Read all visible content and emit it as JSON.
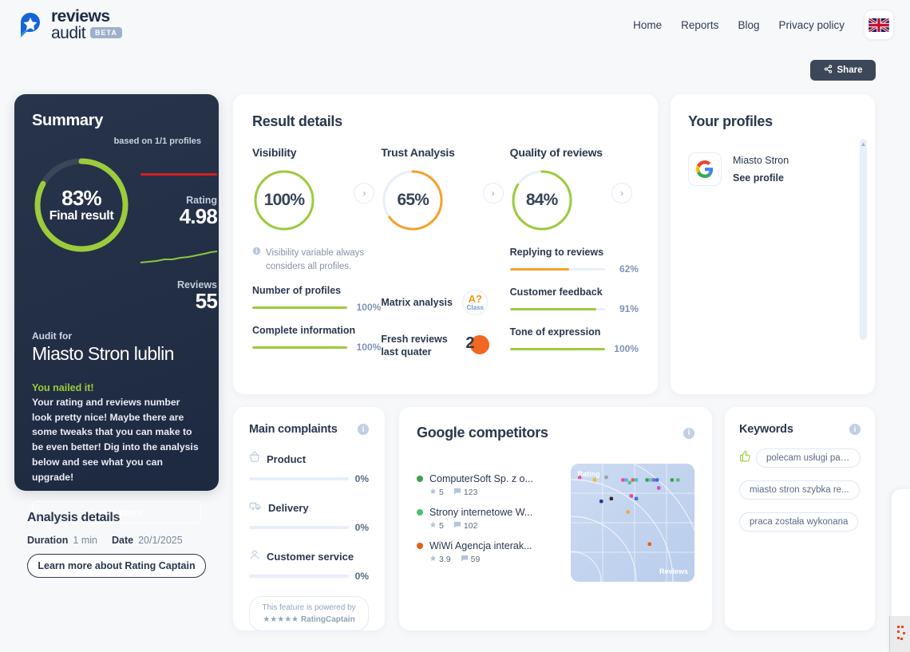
{
  "brand": {
    "line1": "reviews",
    "line2": "audit",
    "badge": "BETA",
    "logo_icon": "star-speech-bubble-icon"
  },
  "nav": {
    "items": [
      {
        "label": "Home"
      },
      {
        "label": "Reports"
      },
      {
        "label": "Blog"
      },
      {
        "label": "Privacy policy"
      }
    ],
    "language_flag": "uk-flag-icon"
  },
  "share": {
    "label": "Share",
    "icon": "share-icon"
  },
  "summary": {
    "title": "Summary",
    "based_on": "based on 1/1 profiles",
    "final_percent": "83%",
    "final_label": "Final result",
    "final_value": 83,
    "rating_label": "Rating",
    "rating_value": "4.98",
    "reviews_label": "Reviews",
    "reviews_value": "55",
    "audit_for_label": "Audit for",
    "audit_name": "Miasto Stron lublin",
    "headline": "You nailed it!",
    "body": "Your rating and reviews number look pretty nice! Maybe there are some tweaks that you can make to be even better! Dig into the analysis below and see what you can upgrade!",
    "cta": "Learn more",
    "ring_color": "#9ccb3b",
    "accent_red": "#d61f1f"
  },
  "analysis": {
    "title": "Analysis details",
    "duration_label": "Duration",
    "duration_value": "1 min",
    "date_label": "Date",
    "date_value": "20/1/2025",
    "cta": "Learn more about Rating Captain"
  },
  "result_details": {
    "title": "Result details",
    "kpis": [
      {
        "label": "Visibility",
        "value": "100%",
        "pct": 100,
        "color": "#9ccb3b"
      },
      {
        "label": "Trust Analysis",
        "value": "65%",
        "pct": 65,
        "color": "#f7a12b"
      },
      {
        "label": "Quality of reviews",
        "value": "84%",
        "pct": 84,
        "color": "#9ccb3b"
      }
    ],
    "note": "Visibility variable always considers all profiles.",
    "note_icon": "info-icon",
    "col1_bars": [
      {
        "label": "Number of profiles",
        "value": "100%",
        "pct": 100,
        "color": "#9ccb3b"
      },
      {
        "label": "Complete information",
        "value": "100%",
        "pct": 100,
        "color": "#9ccb3b"
      }
    ],
    "col2_items": [
      {
        "label": "Matrix analysis",
        "badge_main": "A?",
        "badge_sub": "Class"
      },
      {
        "label": "Fresh reviews last quater",
        "badge_num": "2"
      }
    ],
    "col3_bars": [
      {
        "label": "Replying to reviews",
        "value": "62%",
        "pct": 62,
        "color": "#f7a12b"
      },
      {
        "label": "Customer feedback",
        "value": "91%",
        "pct": 91,
        "color": "#9ccb3b"
      },
      {
        "label": "Tone of expression",
        "value": "100%",
        "pct": 100,
        "color": "#9ccb3b"
      }
    ]
  },
  "profiles": {
    "title": "Your profiles",
    "items": [
      {
        "icon": "google-icon",
        "name": "Miasto Stron",
        "link": "See profile"
      }
    ]
  },
  "complaints": {
    "title": "Main complaints",
    "info_icon": "info-icon",
    "items": [
      {
        "icon": "basket-icon",
        "label": "Product",
        "value": "0%",
        "pct": 0
      },
      {
        "icon": "delivery-van-icon",
        "label": "Delivery",
        "value": "0%",
        "pct": 0
      },
      {
        "icon": "person-icon",
        "label": "Customer service",
        "value": "0%",
        "pct": 0
      }
    ],
    "powered_line1": "This feature is powered by",
    "powered_stars": "★★★★★",
    "powered_brand": "RatingCaptain"
  },
  "competitors": {
    "title": "Google competitors",
    "info_icon": "info-icon",
    "items": [
      {
        "dot": "#3f9f4a",
        "name": "ComputerSoft Sp. z o...",
        "rating": "5",
        "reviews": "123"
      },
      {
        "dot": "#4cc26a",
        "name": "Strony internetowe W...",
        "rating": "5",
        "reviews": "102"
      },
      {
        "dot": "#e2601a",
        "name": "WiWi Agencja interak...",
        "rating": "3.9",
        "reviews": "59"
      }
    ],
    "chart_data": {
      "type": "scatter",
      "title": "Google competitors matrix",
      "xlabel": "Reviews",
      "ylabel": "Rating",
      "grid": true,
      "legend": "none",
      "points": [
        {
          "x": 4,
          "y": 97,
          "color": "#e0559e"
        },
        {
          "x": 22,
          "y": 96,
          "color": "#f5b32a"
        },
        {
          "x": 36,
          "y": 97,
          "color": "#9aa2ad"
        },
        {
          "x": 56,
          "y": 96,
          "color": "#e94fa0"
        },
        {
          "x": 60,
          "y": 96,
          "color": "#6aa9e8"
        },
        {
          "x": 64,
          "y": 95,
          "color": "#4ec98a"
        },
        {
          "x": 68,
          "y": 96,
          "color": "#f05a5a"
        },
        {
          "x": 72,
          "y": 96,
          "color": "#2fd0c8"
        },
        {
          "x": 66,
          "y": 90,
          "color": "#ea46b0"
        },
        {
          "x": 85,
          "y": 96,
          "color": "#3f9f4a"
        },
        {
          "x": 89,
          "y": 96,
          "color": "#6fc3d6"
        },
        {
          "x": 93,
          "y": 96,
          "color": "#7a6fd0"
        },
        {
          "x": 97,
          "y": 96,
          "color": "#2f6fe0"
        },
        {
          "x": 99,
          "y": 93,
          "color": "#d34bc4"
        },
        {
          "x": 115,
          "y": 96,
          "color": "#3f9f4a"
        },
        {
          "x": 122,
          "y": 96,
          "color": "#4cc26a"
        },
        {
          "x": 30,
          "y": 88,
          "color": "#233a8a"
        },
        {
          "x": 42,
          "y": 89,
          "color": "#2b2b2b"
        },
        {
          "x": 72,
          "y": 89,
          "color": "#4a6fd6"
        },
        {
          "x": 62,
          "y": 84,
          "color": "#f0a93a"
        },
        {
          "x": 88,
          "y": 72,
          "color": "#e2601a"
        }
      ],
      "xlim": [
        0,
        140
      ],
      "ylim": [
        60,
        100
      ]
    }
  },
  "keywords": {
    "title": "Keywords",
    "info_icon": "info-icon",
    "items": [
      {
        "icon": "thumbs-up-icon",
        "label": "polecam usługi pan..."
      },
      {
        "icon": null,
        "label": "miasto stron szybka re..."
      },
      {
        "icon": null,
        "label": "praca została wykonana"
      }
    ]
  }
}
